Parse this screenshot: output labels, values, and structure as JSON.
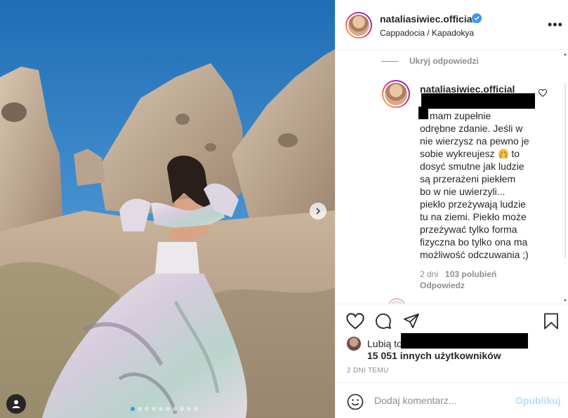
{
  "post": {
    "username": "nataliasiwiec.official",
    "location": "Cappadocia / Kapadokya",
    "more_icon": "more-options-icon",
    "image_dots_count": 10
  },
  "comments": {
    "hide_replies": "Ukryj odpowiedzi",
    "reply": {
      "username": "nataliasiwiec.official",
      "lines": [
        "mam zupełnie",
        "odrębne zdanie. Jeśli w",
        "nie wierzysz na pewno je",
        "sobie wykreujesz",
        "to",
        "dosyć smutne jak ludzie",
        "są przerażeni piekłem",
        "bo w nie uwierzyli...",
        "piekło przeżywają ludzie",
        "tu na ziemi. Piekło może",
        "przeżywać tylko forma",
        "fizyczna bo tylko ona ma",
        "możliwość odczuwania ;)"
      ],
      "age": "2 dni",
      "likes": "103 polubień",
      "reply_label": "Odpowiedz"
    }
  },
  "likes": {
    "prefix": "Lubią to",
    "others": "15 051 innych użytkowników"
  },
  "timestamp": "2 DNI TEMU",
  "add_comment": {
    "placeholder": "Dodaj komentarz...",
    "publish": "Opublikuj"
  },
  "colors": {
    "accent": "#3897f0",
    "publish_disabled": "#b2dffc",
    "secondary_text": "#8e8e8e",
    "sky": "#2f7fc4"
  }
}
